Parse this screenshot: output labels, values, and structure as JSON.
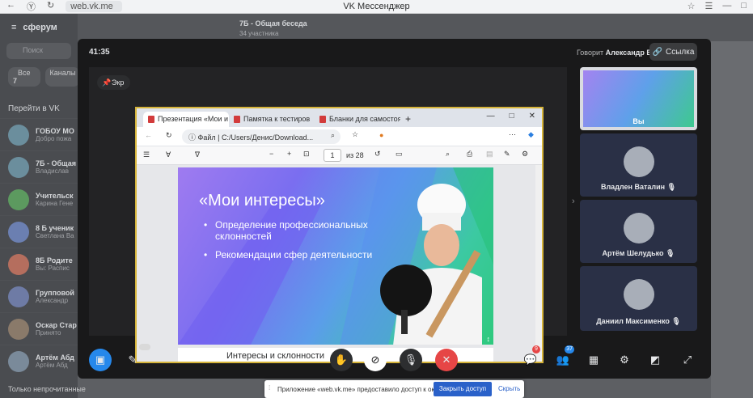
{
  "browser": {
    "url": "web.vk.me",
    "window_title": "VK Мессенджер"
  },
  "bg_app": {
    "brand": "сферум",
    "search_placeholder": "Поиск",
    "filter_all": "Все",
    "filter_all_count": "7",
    "filter_channels": "Каналы",
    "goto_label": "Перейти в VK",
    "active_chat_title": "7Б - Общая беседа",
    "active_chat_subtitle": "34 участника",
    "chats": [
      {
        "title": "ГОБОУ МО",
        "subtitle": "Добро пожа"
      },
      {
        "title": "7Б - Общая",
        "subtitle": "Владислав"
      },
      {
        "title": "Учительск",
        "subtitle": "Карина Гене"
      },
      {
        "title": "8 Б ученик",
        "subtitle": "Светлана Ва"
      },
      {
        "title": "8Б Родите",
        "subtitle": "Вы: Распис"
      },
      {
        "title": "Групповой",
        "subtitle": "Александр"
      },
      {
        "title": "Оскар Стар",
        "subtitle": "Принято"
      },
      {
        "title": "Артём Абд",
        "subtitle": "Артём Абд"
      }
    ],
    "unread_only_label": "Только непрочитанные"
  },
  "call": {
    "timer": "41:35",
    "speaking_prefix": "Говорит",
    "speaking_name": "Александр В.",
    "link_label": "Ссылка",
    "screen_label": "Экр"
  },
  "shared_screen": {
    "tabs": [
      "Презентация «Мои и",
      "Памятка к тестиров",
      "Бланки для самостоя"
    ],
    "address_prefix": "Файл",
    "address": "C:/Users/Денис/Download...",
    "page_current": "1",
    "page_total": "из 28",
    "slide": {
      "title": "«Мои интересы»",
      "bullets": [
        "Определение профессиональных склонностей",
        "Рекомендации сфер деятельности"
      ]
    },
    "next_page_title": "Интересы и склонности"
  },
  "participants": [
    {
      "name": "Вы",
      "is_screen": true
    },
    {
      "name": "Владлен Ваталин"
    },
    {
      "name": "Артём Шелудько"
    },
    {
      "name": "Даниил Максименко"
    }
  ],
  "controls": {
    "chat_badge": "9",
    "participants_badge": "37"
  },
  "notification": {
    "text": "Приложение «web.vk.me» предоставило доступ к окну.",
    "close_label": "Закрыть доступ",
    "hide_label": "Скрыть"
  },
  "colors": {
    "end_call": "#e64646",
    "primary": "#2a61c9",
    "screen_share": "#2688eb"
  }
}
